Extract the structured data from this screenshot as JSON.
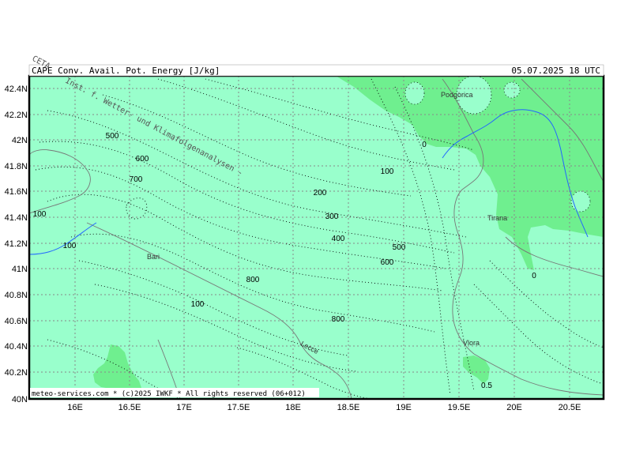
{
  "header": {
    "title": "CAPE  Conv. Avail. Pot. Energy [J/kg]",
    "valid_time": "05.07.2025 18 UTC"
  },
  "watermark": {
    "prefix": "CETA",
    "text": "Inst. f. Wetter- und Klimafolgenanalysen -"
  },
  "footer": {
    "credit": "meteo-services.com * (c)2025 IWKF * All rights reserved (06+012)"
  },
  "axes": {
    "lon_ticks": [
      "16E",
      "16.5E",
      "17E",
      "17.5E",
      "18E",
      "18.5E",
      "19E",
      "19.5E",
      "20E",
      "20.5E"
    ],
    "lat_ticks": [
      "42.4N",
      "42.2N",
      "42N",
      "41.8N",
      "41.6N",
      "41.4N",
      "41.2N",
      "41N",
      "40.8N",
      "40.6N",
      "40.4N",
      "40.2N",
      "40N"
    ]
  },
  "cities": [
    "Podgorica",
    "Tirana",
    "Bari",
    "Lecce",
    "Vlora"
  ],
  "contour_labels": [
    "500",
    "600",
    "700",
    "100",
    "100",
    "800",
    "100",
    "200",
    "300",
    "400",
    "500",
    "600",
    "800",
    "100",
    "0",
    "0",
    "0.5"
  ],
  "colors": {
    "background": "#99ffcc",
    "high_cape_area": "#6fef8f",
    "grid": "#888888",
    "coast": "#777777",
    "river": "#2266ff",
    "frame": "#000000"
  }
}
